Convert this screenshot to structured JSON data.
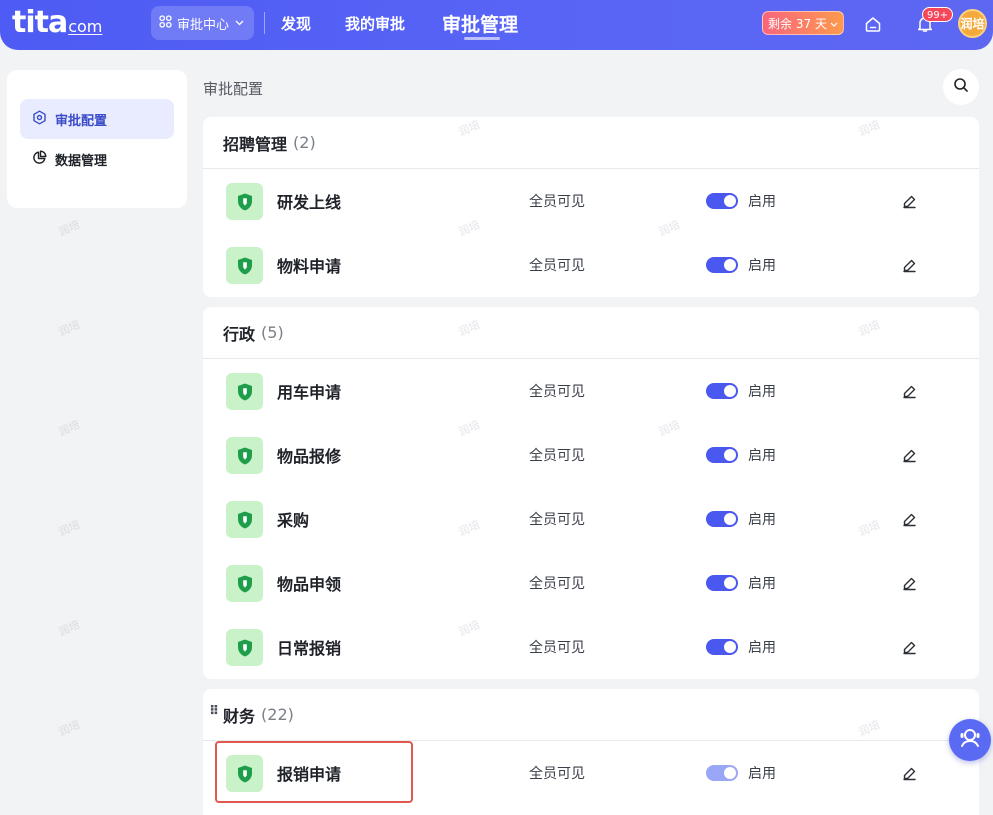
{
  "topbar": {
    "logo_text": "tita",
    "logo_suffix": "com",
    "switcher_label": "审批中心",
    "nav": [
      "发现",
      "我的审批",
      "审批管理"
    ],
    "trial_label": "剩余 37 天",
    "notification_count": "99+",
    "avatar_text": "润培"
  },
  "sidebar": {
    "items": [
      {
        "label": "审批配置",
        "active": true
      },
      {
        "label": "数据管理",
        "active": false
      }
    ]
  },
  "page": {
    "title": "审批配置"
  },
  "groups": [
    {
      "name": "招聘管理",
      "count": "(2)",
      "rows": [
        {
          "name": "研发上线",
          "scope": "全员可见",
          "status": "启用"
        },
        {
          "name": "物料申请",
          "scope": "全员可见",
          "status": "启用"
        }
      ]
    },
    {
      "name": "行政",
      "count": "(5)",
      "rows": [
        {
          "name": "用车申请",
          "scope": "全员可见",
          "status": "启用"
        },
        {
          "name": "物品报修",
          "scope": "全员可见",
          "status": "启用"
        },
        {
          "name": "采购",
          "scope": "全员可见",
          "status": "启用"
        },
        {
          "name": "物品申领",
          "scope": "全员可见",
          "status": "启用"
        },
        {
          "name": "日常报销",
          "scope": "全员可见",
          "status": "启用"
        }
      ]
    },
    {
      "name": "财务",
      "count": "(22)",
      "rows": [
        {
          "name": "报销申请",
          "scope": "全员可见",
          "status": "启用"
        }
      ]
    }
  ],
  "watermark": "润培",
  "colors": {
    "brand": "#4e5bf4",
    "toggle_on": "#4a58f0",
    "app_icon_bg": "#c9f2c9",
    "app_icon_fg": "#1e9e4a",
    "highlight": "#e0584e"
  }
}
